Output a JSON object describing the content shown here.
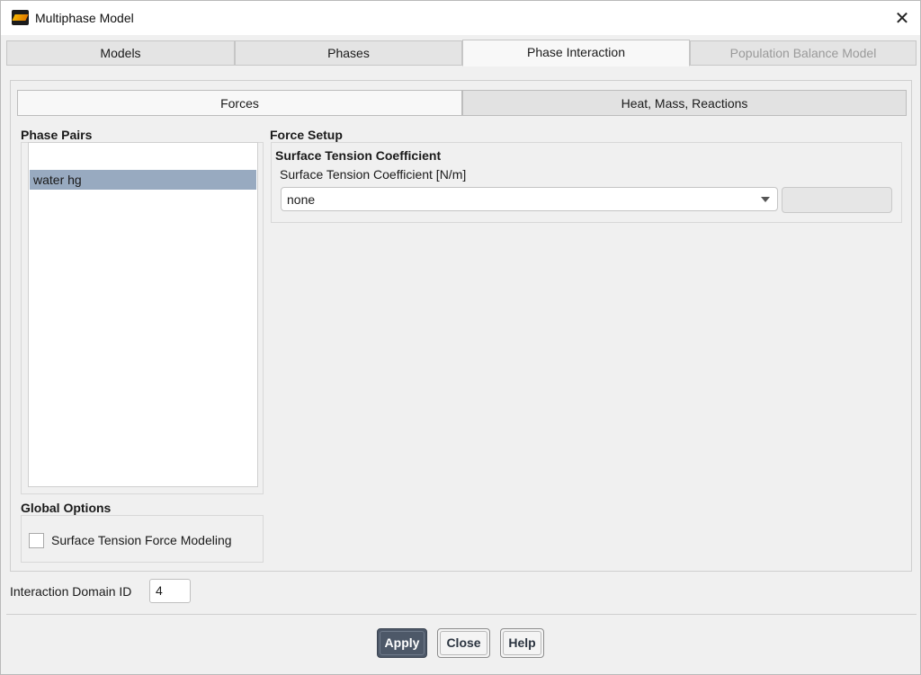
{
  "window": {
    "title": "Multiphase Model",
    "close_glyph": "✕"
  },
  "tabs": [
    {
      "label": "Models",
      "state": "normal"
    },
    {
      "label": "Phases",
      "state": "normal"
    },
    {
      "label": "Phase Interaction",
      "state": "active"
    },
    {
      "label": "Population Balance Model",
      "state": "disabled"
    }
  ],
  "subtabs": {
    "forces": "Forces",
    "heat_mass": "Heat, Mass, Reactions"
  },
  "phase_pairs": {
    "title": "Phase Pairs",
    "items": [
      "water hg"
    ],
    "selected": "water hg"
  },
  "global_options": {
    "title": "Global Options",
    "surface_tension_force_modeling": {
      "label": "Surface Tension Force Modeling",
      "checked": false
    }
  },
  "force_setup": {
    "title": "Force Setup",
    "subtitle": "Surface Tension Coefficient",
    "field_label": "Surface Tension Coefficient [N/m]",
    "method_value": "none",
    "coefficient_value": ""
  },
  "interaction_domain": {
    "label": "Interaction Domain ID",
    "value": "4"
  },
  "buttons": {
    "apply": "Apply",
    "close": "Close",
    "help": "Help"
  },
  "colors": {
    "selection": "#98aac0",
    "primary_button": "#4d5868"
  }
}
